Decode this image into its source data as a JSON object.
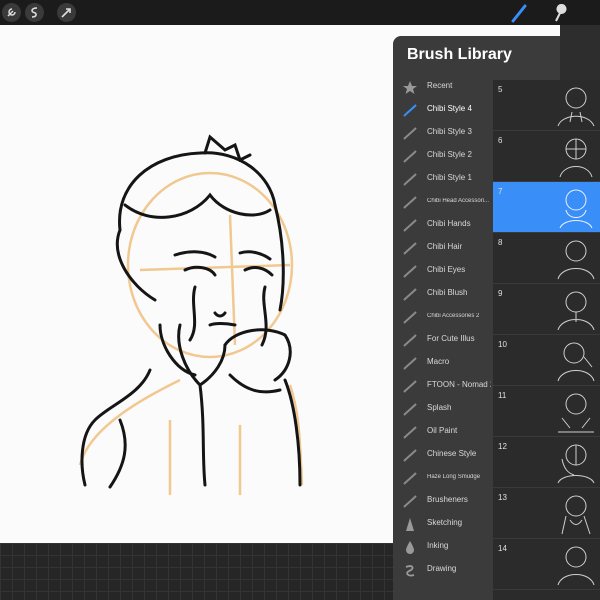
{
  "panel": {
    "title": "Brush Library",
    "categories": [
      {
        "label": "Recent",
        "icon": "star-icon"
      },
      {
        "label": "Chibi Style 4",
        "icon": "brush-stroke-icon",
        "active": true
      },
      {
        "label": "Chibi Style 3",
        "icon": "brush-stroke-icon"
      },
      {
        "label": "Chibi Style 2",
        "icon": "brush-stroke-icon"
      },
      {
        "label": "Chibi Style 1",
        "icon": "brush-stroke-icon"
      },
      {
        "label": "Chibi Head Accessori...",
        "icon": "brush-stroke-icon",
        "small": true
      },
      {
        "label": "Chibi Hands",
        "icon": "brush-stroke-icon"
      },
      {
        "label": "Chibi Hair",
        "icon": "brush-stroke-icon"
      },
      {
        "label": "Chibi Eyes",
        "icon": "brush-stroke-icon"
      },
      {
        "label": "Chibi Blush",
        "icon": "brush-stroke-icon"
      },
      {
        "label": "Chibi Accessories 2",
        "icon": "brush-stroke-icon",
        "small": true
      },
      {
        "label": "For Cute Illus",
        "icon": "brush-stroke-icon"
      },
      {
        "label": "Macro",
        "icon": "brush-stroke-icon"
      },
      {
        "label": "FTOON - Nomad 2",
        "icon": "brush-stroke-icon"
      },
      {
        "label": "Splash",
        "icon": "brush-stroke-icon"
      },
      {
        "label": "Oil Paint",
        "icon": "brush-stroke-icon"
      },
      {
        "label": "Chinese Style",
        "icon": "brush-stroke-icon"
      },
      {
        "label": "Haze Long Smudge",
        "icon": "brush-stroke-icon",
        "small": true
      },
      {
        "label": "Brusheners",
        "icon": "brush-stroke-icon"
      },
      {
        "label": "Sketching",
        "icon": "pencil-tip-icon"
      },
      {
        "label": "Inking",
        "icon": "ink-drop-icon"
      },
      {
        "label": "Drawing",
        "icon": "squiggle-icon"
      }
    ],
    "brushes": [
      {
        "num": "5"
      },
      {
        "num": "6"
      },
      {
        "num": "7",
        "selected": true
      },
      {
        "num": "8"
      },
      {
        "num": "9"
      },
      {
        "num": "10"
      },
      {
        "num": "11"
      },
      {
        "num": "12"
      },
      {
        "num": "13"
      },
      {
        "num": "14"
      }
    ]
  },
  "colors": {
    "accent": "#3a8ef7",
    "panel": "#3b3b3b",
    "sketch_guide": "#f0c890"
  },
  "toolbar_icons": [
    "wrench-icon",
    "adjustments-icon",
    "selection-icon",
    "brush-tool-icon",
    "smudge-icon"
  ]
}
